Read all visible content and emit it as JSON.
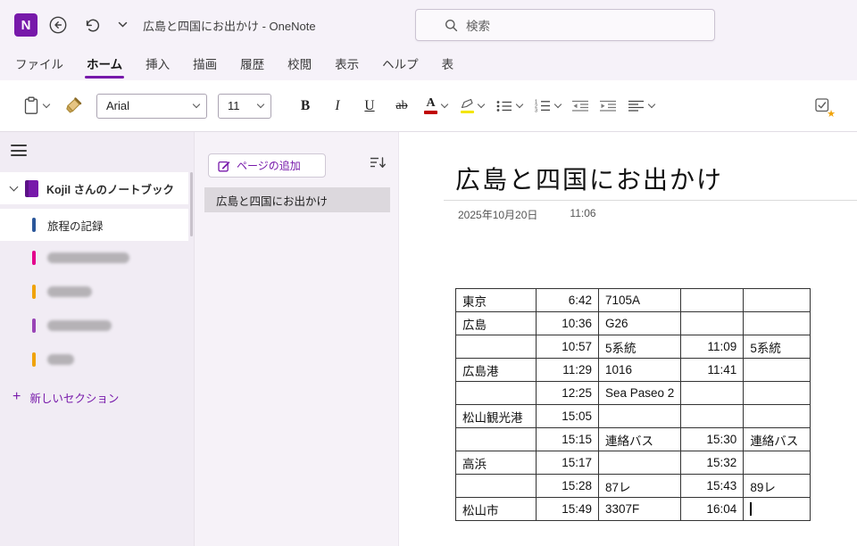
{
  "colors": {
    "accent": "#7719AA",
    "font_color_bar": "#C00000",
    "highlight_bar": "#F3E500",
    "tag_star": "#F0A30A"
  },
  "titlebar": {
    "logo_letter": "N",
    "app_title": "広島と四国にお出かけ  -  OneNote",
    "search_placeholder": "検索"
  },
  "menu": {
    "tabs": [
      {
        "key": "file",
        "label": "ファイル"
      },
      {
        "key": "home",
        "label": "ホーム",
        "active": true
      },
      {
        "key": "insert",
        "label": "挿入"
      },
      {
        "key": "draw",
        "label": "描画"
      },
      {
        "key": "history",
        "label": "履歴"
      },
      {
        "key": "review",
        "label": "校閲"
      },
      {
        "key": "view",
        "label": "表示"
      },
      {
        "key": "help",
        "label": "ヘルプ"
      },
      {
        "key": "table",
        "label": "表"
      }
    ]
  },
  "toolbar": {
    "font_name": "Arial",
    "font_size": "11",
    "bold_label": "B",
    "italic_label": "I",
    "underline_label": "U",
    "strikethrough_label": "ab",
    "font_color_label": "A"
  },
  "sidebar": {
    "notebook_label": "KojiI さんのノートブック",
    "sections": [
      {
        "key": "itinerary",
        "label": "旅程の記録",
        "color": "#2B579A",
        "selected": true
      },
      {
        "key": "redacted-1",
        "label": "",
        "color": "#E3008C",
        "redacted": true
      },
      {
        "key": "redacted-2",
        "label": "",
        "color": "#F0A30A",
        "redacted": true
      },
      {
        "key": "redacted-3",
        "label": "",
        "color": "#9A44B6",
        "redacted": true
      },
      {
        "key": "redacted-4",
        "label": "",
        "color": "#F0A30A",
        "redacted": true
      }
    ],
    "new_section_plus": "+",
    "new_section_label": "新しいセクション"
  },
  "pages": {
    "add_page_label": "ページの追加",
    "items": [
      {
        "label": "広島と四国にお出かけ",
        "selected": true
      }
    ]
  },
  "page": {
    "title": "広島と四国にお出かけ",
    "date": "2025年10月20日",
    "time": "11:06",
    "table": {
      "rows": [
        [
          "東京",
          "6:42",
          "7105A",
          "",
          ""
        ],
        [
          "広島",
          "10:36",
          "G26",
          "",
          ""
        ],
        [
          "",
          "10:57",
          "5系統",
          "11:09",
          "5系統"
        ],
        [
          "広島港",
          "11:29",
          "1016",
          "11:41",
          ""
        ],
        [
          "",
          "12:25",
          "Sea Paseo 2",
          "",
          ""
        ],
        [
          "松山観光港",
          "15:05",
          "",
          "",
          ""
        ],
        [
          "",
          "15:15",
          "連絡バス",
          "15:30",
          "連絡バス"
        ],
        [
          "高浜",
          "15:17",
          "",
          "15:32",
          ""
        ],
        [
          "",
          "15:28",
          "87レ",
          "15:43",
          "89レ"
        ],
        [
          "松山市",
          "15:49",
          "3307F",
          "16:04",
          ""
        ]
      ],
      "caret_cell": {
        "row": 9,
        "col": 4
      }
    }
  }
}
